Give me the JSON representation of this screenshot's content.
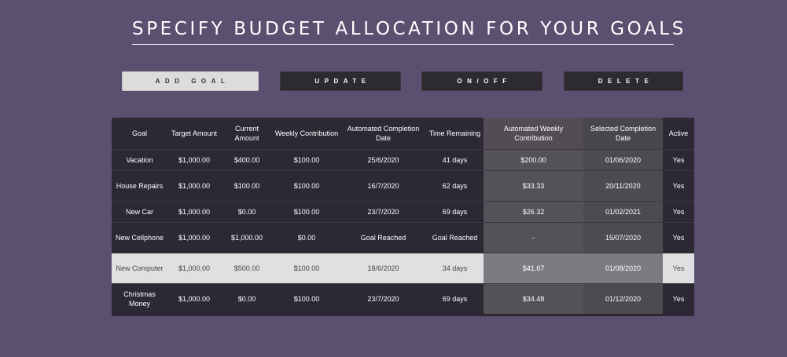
{
  "header": {
    "title": "SPECIFY BUDGET ALLOCATION FOR YOUR GOALS"
  },
  "toolbar": {
    "add_goal": "ADD GOAL",
    "update": "UPDATE",
    "on_off": "ON/OFF",
    "delete": "DELETE"
  },
  "table": {
    "headers": {
      "goal": "Goal",
      "target_amount": "Target Amount",
      "current_amount": "Current Amount",
      "weekly_contribution": "Weekly Contribution",
      "automated_completion_date": "Automated Completion Date",
      "time_remaining": "Time Remaining",
      "automated_weekly_contribution": "Automated Weekly Contribution",
      "selected_completion_date": "Selected Completion Date",
      "active": "Active"
    },
    "rows": [
      {
        "goal": "Vacation",
        "target": "$1,000.00",
        "current": "$400.00",
        "weekly": "$100.00",
        "auto_date": "25/6/2020",
        "remaining": "41 days",
        "auto_weekly": "$200.00",
        "sel_date": "01/06/2020",
        "active": "Yes"
      },
      {
        "goal": "House Repairs",
        "target": "$1,000.00",
        "current": "$100.00",
        "weekly": "$100.00",
        "auto_date": "16/7/2020",
        "remaining": "62 days",
        "auto_weekly": "$33.33",
        "sel_date": "20/11/2020",
        "active": "Yes"
      },
      {
        "goal": "New Car",
        "target": "$1,000.00",
        "current": "$0.00",
        "weekly": "$100.00",
        "auto_date": "23/7/2020",
        "remaining": "69 days",
        "auto_weekly": "$26.32",
        "sel_date": "01/02/2021",
        "active": "Yes"
      },
      {
        "goal": "New Cellphone",
        "target": "$1,000.00",
        "current": "$1,000.00",
        "weekly": "$0.00",
        "auto_date": "Goal Reached",
        "remaining": "Goal Reached",
        "auto_weekly": "-",
        "sel_date": "15/07/2020",
        "active": "Yes"
      },
      {
        "goal": "New Computer",
        "target": "$1,000.00",
        "current": "$500.00",
        "weekly": "$100.00",
        "auto_date": "18/6/2020",
        "remaining": "34 days",
        "auto_weekly": "$41.67",
        "sel_date": "01/08/2020",
        "active": "Yes"
      },
      {
        "goal": "Christmas Money",
        "target": "$1,000.00",
        "current": "$0.00",
        "weekly": "$100.00",
        "auto_date": "23/7/2020",
        "remaining": "69 days",
        "auto_weekly": "$34.48",
        "sel_date": "01/12/2020",
        "active": "Yes"
      }
    ]
  },
  "colors": {
    "background": "#5b5070",
    "table_dark": "#2c2834",
    "selected_row": "#e0e0e2",
    "button_dark": "#2d2a30",
    "button_light": "#dcdcdc"
  }
}
